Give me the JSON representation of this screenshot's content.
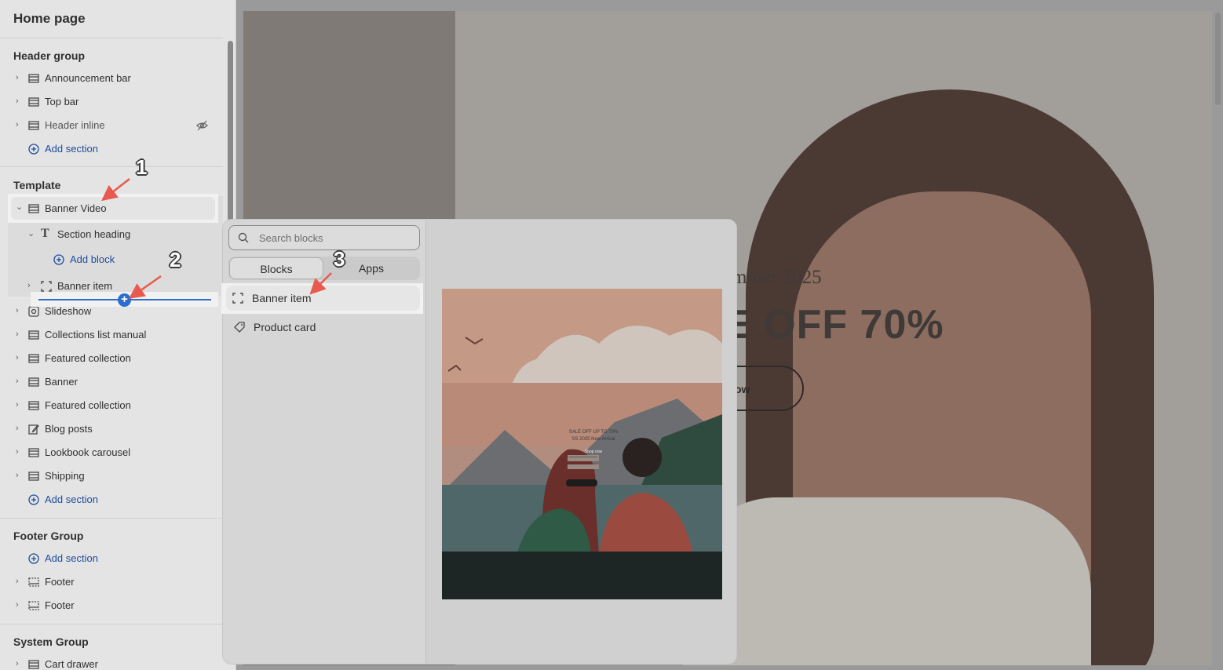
{
  "sidebar": {
    "title": "Home page",
    "groups": {
      "header": {
        "title": "Header group",
        "items": [
          {
            "label": "Announcement bar",
            "icon": "section-icon"
          },
          {
            "label": "Top bar",
            "icon": "section-icon"
          },
          {
            "label": "Header inline",
            "icon": "section-icon",
            "hidden": true
          }
        ],
        "add_label": "Add section"
      },
      "template": {
        "title": "Template",
        "selected": "Banner Video",
        "section_heading": "Section heading",
        "add_block": "Add block",
        "banner_item": "Banner item",
        "items": [
          {
            "label": "Slideshow",
            "icon": "slideshow-icon"
          },
          {
            "label": "Collections list manual",
            "icon": "section-icon"
          },
          {
            "label": "Featured collection",
            "icon": "section-icon"
          },
          {
            "label": "Banner",
            "icon": "section-icon"
          },
          {
            "label": "Featured collection",
            "icon": "section-icon"
          },
          {
            "label": "Blog posts",
            "icon": "edit-icon"
          },
          {
            "label": "Lookbook carousel",
            "icon": "section-icon"
          },
          {
            "label": "Shipping",
            "icon": "section-icon"
          }
        ],
        "add_label": "Add section"
      },
      "footer": {
        "title": "Footer Group",
        "add_label": "Add section",
        "items": [
          {
            "label": "Footer",
            "icon": "footer-icon"
          },
          {
            "label": "Footer",
            "icon": "footer-icon"
          }
        ]
      },
      "system": {
        "title": "System Group",
        "items": [
          {
            "label": "Cart drawer",
            "icon": "section-icon"
          }
        ]
      }
    }
  },
  "popover": {
    "search_placeholder": "Search blocks",
    "tabs": [
      "Blocks",
      "Apps"
    ],
    "active_tab": "Blocks",
    "blocks": [
      {
        "label": "Banner item",
        "icon": "banner-item-icon"
      },
      {
        "label": "Product card",
        "icon": "tag-icon"
      }
    ],
    "preview_text": [
      "SALE OFF UP TO 70%",
      "SS 2025 New Arrival",
      "Shop now"
    ]
  },
  "preview": {
    "subtitle": "mmer 2025",
    "headline": "E OFF 70%",
    "button": "ow"
  },
  "annotations": [
    "1",
    "2",
    "3"
  ],
  "colors": {
    "accent": "#2c6ecb",
    "arrow": "#e85a4f",
    "link": "#1f4d9b"
  }
}
